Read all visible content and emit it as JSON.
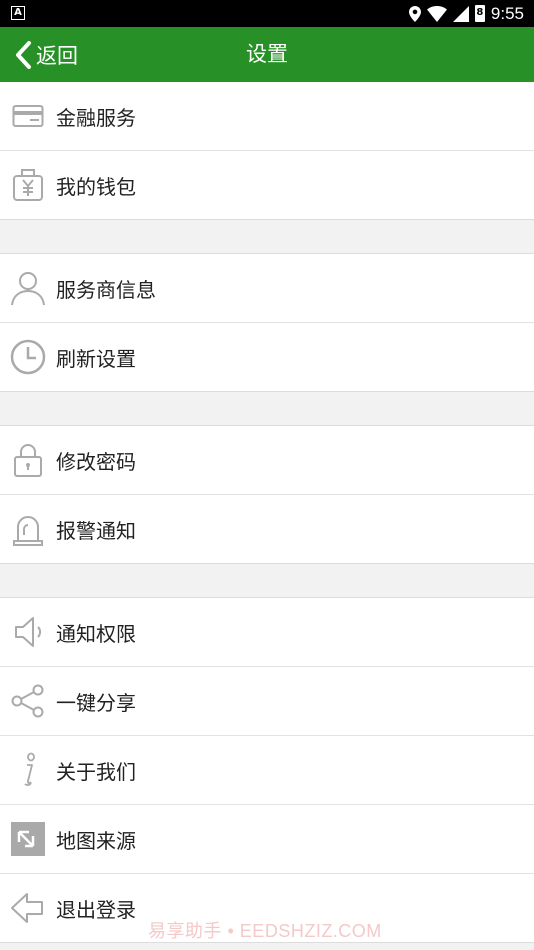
{
  "status_bar": {
    "time": "9:55",
    "left_badge": "A",
    "battery_digit": "8",
    "icons": [
      "location-icon",
      "wifi-icon",
      "cell-signal-icon",
      "battery-icon"
    ]
  },
  "header": {
    "back_label": "返回",
    "title": "设置",
    "background": "#279128"
  },
  "groups": [
    [
      {
        "label": "金融服务",
        "icon": "credit-card-icon"
      },
      {
        "label": "我的钱包",
        "icon": "wallet-icon"
      }
    ],
    [
      {
        "label": "服务商信息",
        "icon": "person-icon"
      },
      {
        "label": "刷新设置",
        "icon": "clock-icon"
      }
    ],
    [
      {
        "label": "修改密码",
        "icon": "lock-icon"
      },
      {
        "label": "报警通知",
        "icon": "alarm-bell-icon"
      }
    ],
    [
      {
        "label": "通知权限",
        "icon": "speaker-icon"
      },
      {
        "label": "一键分享",
        "icon": "share-icon"
      },
      {
        "label": "关于我们",
        "icon": "info-icon"
      },
      {
        "label": "地图来源",
        "icon": "map-source-icon"
      },
      {
        "label": "退出登录",
        "icon": "logout-arrow-icon"
      }
    ]
  ],
  "watermark": "易享助手 • EEDSHZIZ.COM"
}
